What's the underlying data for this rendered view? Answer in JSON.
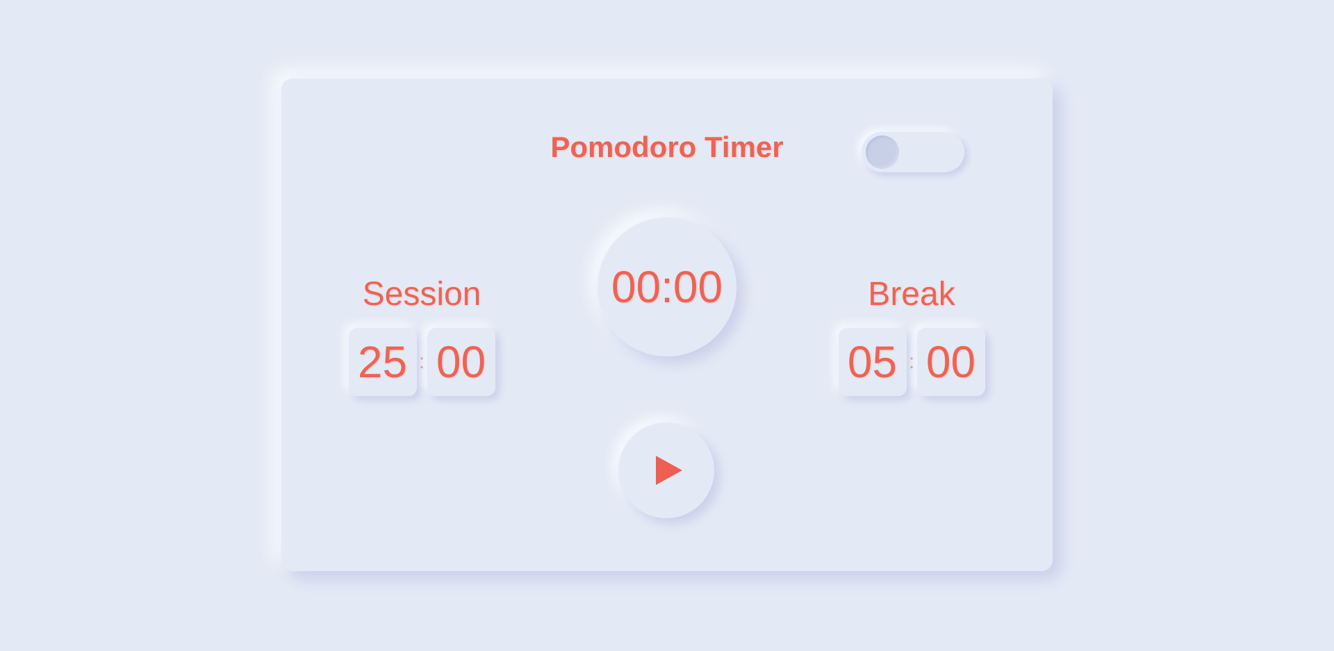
{
  "app": {
    "title": "Pomodoro Timer"
  },
  "timer": {
    "display": "00:00"
  },
  "session": {
    "label": "Session",
    "minutes": "25",
    "separator": ":",
    "seconds": "00"
  },
  "break": {
    "label": "Break",
    "minutes": "05",
    "separator": ":",
    "seconds": "00"
  },
  "controls": {
    "play_icon": "play-icon",
    "theme_toggle_on": false
  },
  "colors": {
    "accent": "#ee6352",
    "background": "#e4eaf5",
    "toggle_knob": "#c8d0e8"
  }
}
